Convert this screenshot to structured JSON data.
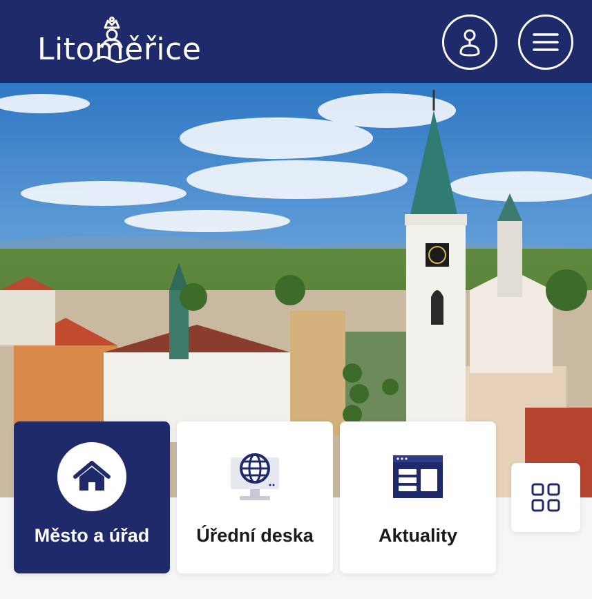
{
  "header": {
    "logo_text": "Litoměřice",
    "logo_icon": "king-crown-logo-icon",
    "user_button_icon": "user-icon",
    "menu_button_icon": "hamburger-menu-icon"
  },
  "hero": {
    "image_subject": "town panorama"
  },
  "tiles": [
    {
      "label": "Město a úřad",
      "icon": "home-icon",
      "active": true
    },
    {
      "label": "Úřední deska",
      "icon": "globe-monitor-icon",
      "active": false
    },
    {
      "label": "Aktuality",
      "icon": "news-page-icon",
      "active": false
    }
  ],
  "more_button_icon": "grid-icon",
  "colors": {
    "brand_navy": "#1f2a6b",
    "background": "#f5f5f5",
    "tile_bg": "#ffffff"
  }
}
